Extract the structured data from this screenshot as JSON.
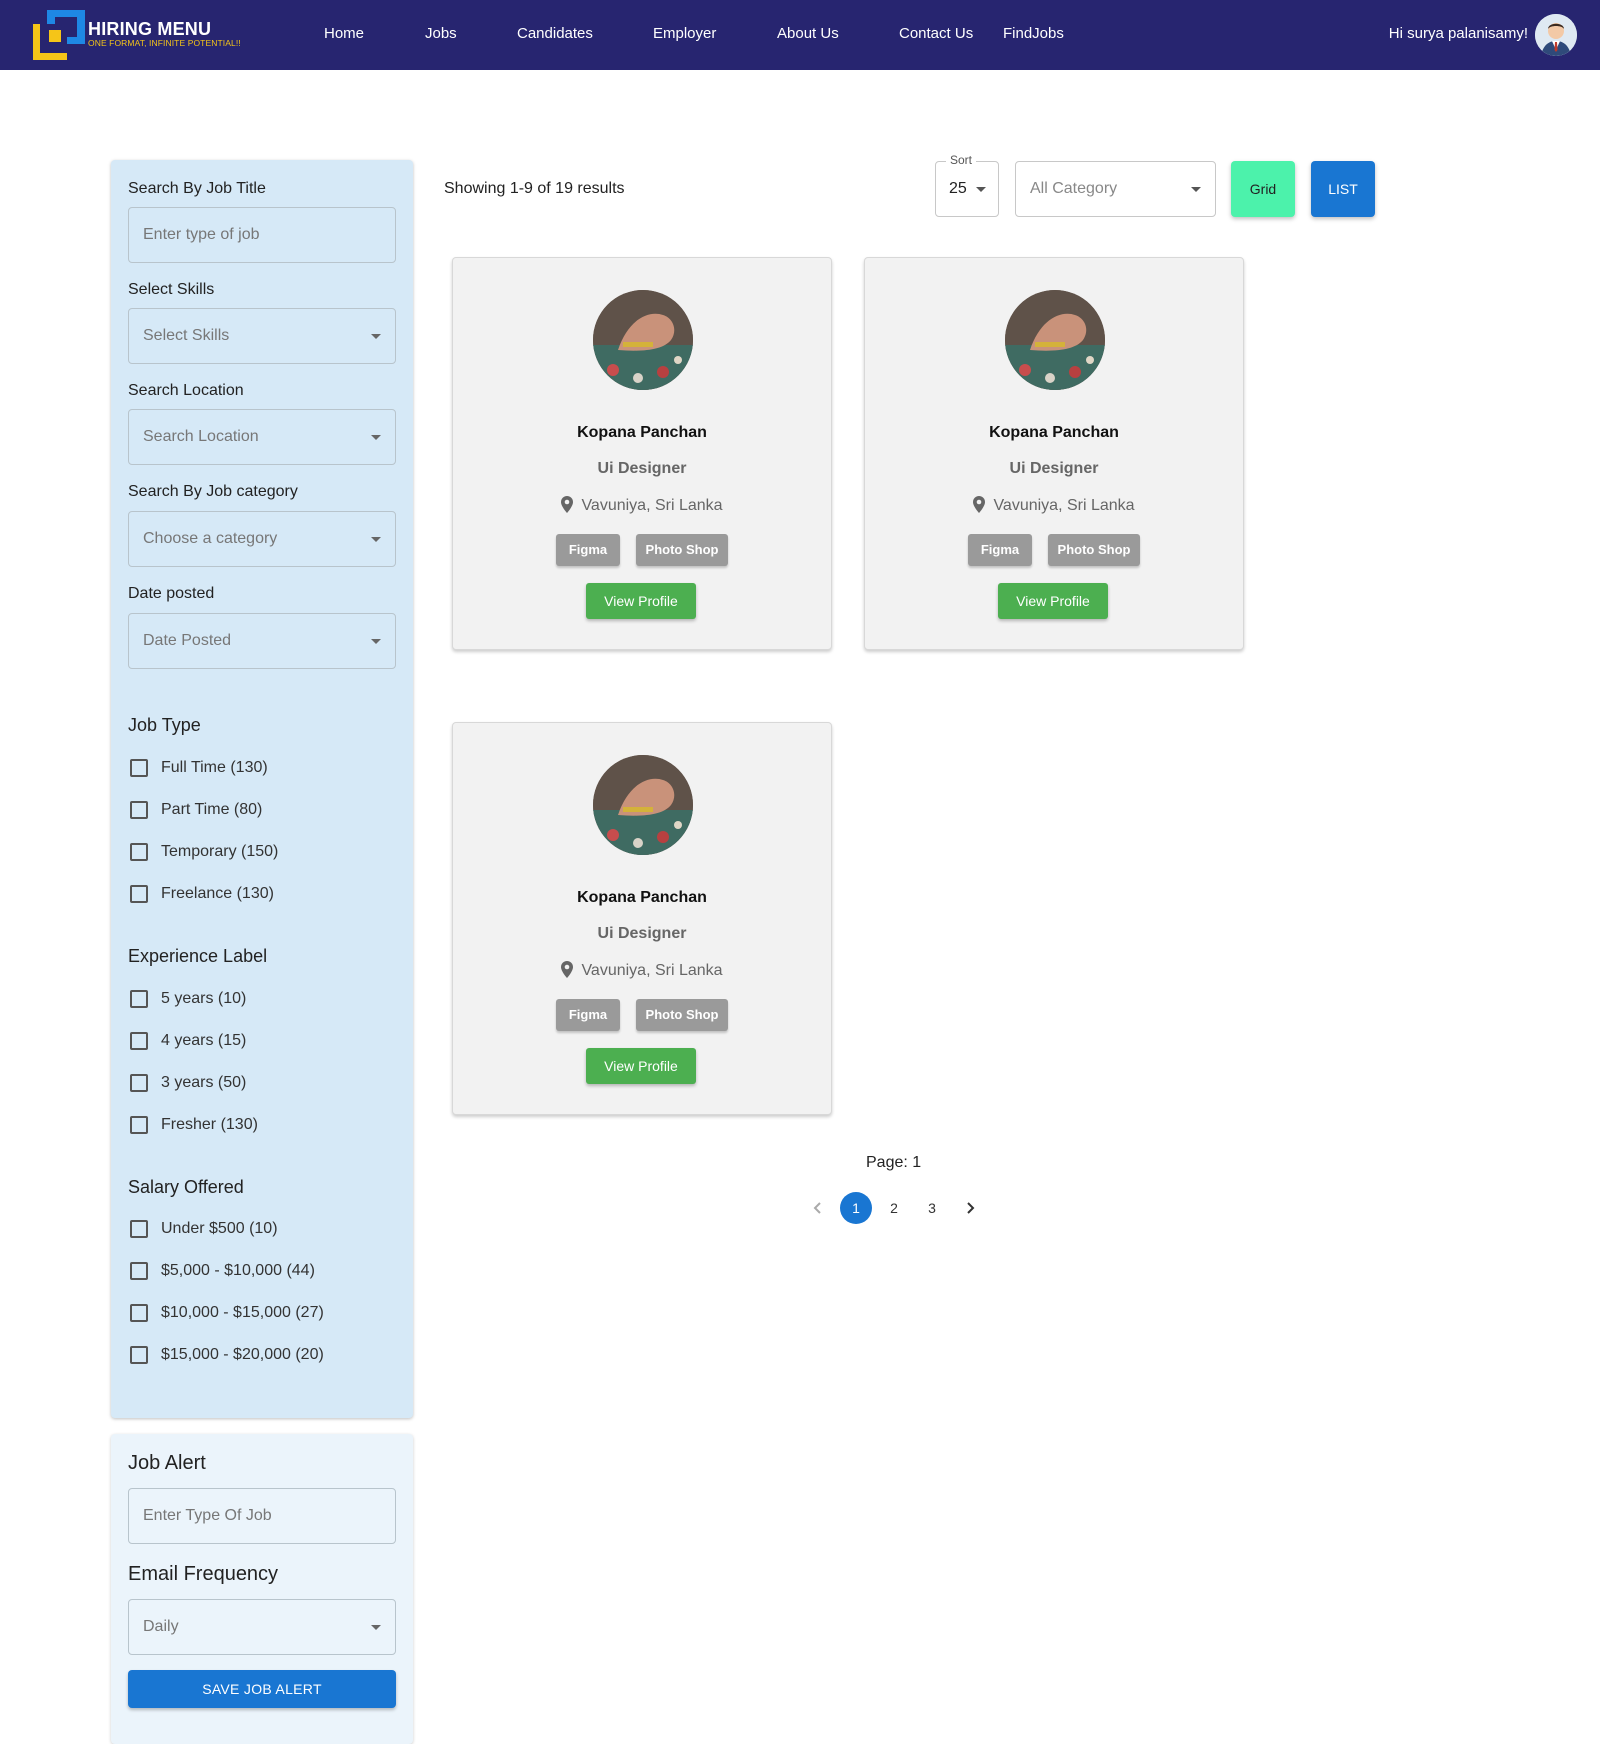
{
  "header": {
    "brand": "HIRING MENU",
    "tagline": "ONE FORMAT, INFINITE POTENTIAL!!",
    "nav": [
      "Home",
      "Jobs",
      "Candidates",
      "Employer",
      "About Us",
      "Contact Us",
      "FindJobs"
    ],
    "greeting": "Hi surya palanisamy!",
    "colors": {
      "bar": "#272570",
      "logo_blue": "#1e88e5",
      "logo_yellow": "#f5c518"
    }
  },
  "filters": {
    "job_title": {
      "label": "Search By Job Title",
      "placeholder": "Enter type of job"
    },
    "skills": {
      "label": "Select Skills",
      "placeholder": "Select Skills"
    },
    "location": {
      "label": "Search Location",
      "placeholder": "Search Location"
    },
    "category": {
      "label": "Search By Job category",
      "placeholder": "Choose a category"
    },
    "date_posted": {
      "label": "Date posted",
      "placeholder": "Date Posted"
    },
    "job_type": {
      "title": "Job Type",
      "options": [
        "Full Time (130)",
        "Part Time (80)",
        "Temporary (150)",
        "Freelance (130)"
      ]
    },
    "experience": {
      "title": "Experience Label",
      "options": [
        "5 years (10)",
        "4 years (15)",
        "3 years (50)",
        "Fresher (130)"
      ]
    },
    "salary": {
      "title": "Salary Offered",
      "options": [
        "Under $500 (10)",
        "$5,000 - $10,000 (44)",
        "$10,000 - $15,000 (27)",
        "$15,000 - $20,000 (20)"
      ]
    }
  },
  "job_alert": {
    "title": "Job Alert",
    "placeholder": "Enter Type Of Job",
    "frequency_title": "Email Frequency",
    "frequency_value": "Daily",
    "save_label": "SAVE JOB ALERT"
  },
  "toolbar": {
    "results": "Showing 1-9 of 19 results",
    "sort_label": "Sort",
    "sort_value": "25",
    "category_value": "All Category",
    "grid_label": "Grid",
    "list_label": "LIST",
    "colors": {
      "grid": "#4cf2ab",
      "list": "#1976d2"
    }
  },
  "candidates": [
    {
      "name": "Kopana Panchan",
      "role": "Ui Designer",
      "location": "Vavuniya, Sri Lanka",
      "skills": [
        "Figma",
        "Photo Shop"
      ],
      "action": "View Profile"
    },
    {
      "name": "Kopana Panchan",
      "role": "Ui Designer",
      "location": "Vavuniya, Sri Lanka",
      "skills": [
        "Figma",
        "Photo Shop"
      ],
      "action": "View Profile"
    },
    {
      "name": "Kopana Panchan",
      "role": "Ui Designer",
      "location": "Vavuniya, Sri Lanka",
      "skills": [
        "Figma",
        "Photo Shop"
      ],
      "action": "View Profile"
    }
  ],
  "pagination": {
    "label": "Page: 1",
    "pages": [
      "1",
      "2",
      "3"
    ],
    "current": "1"
  }
}
